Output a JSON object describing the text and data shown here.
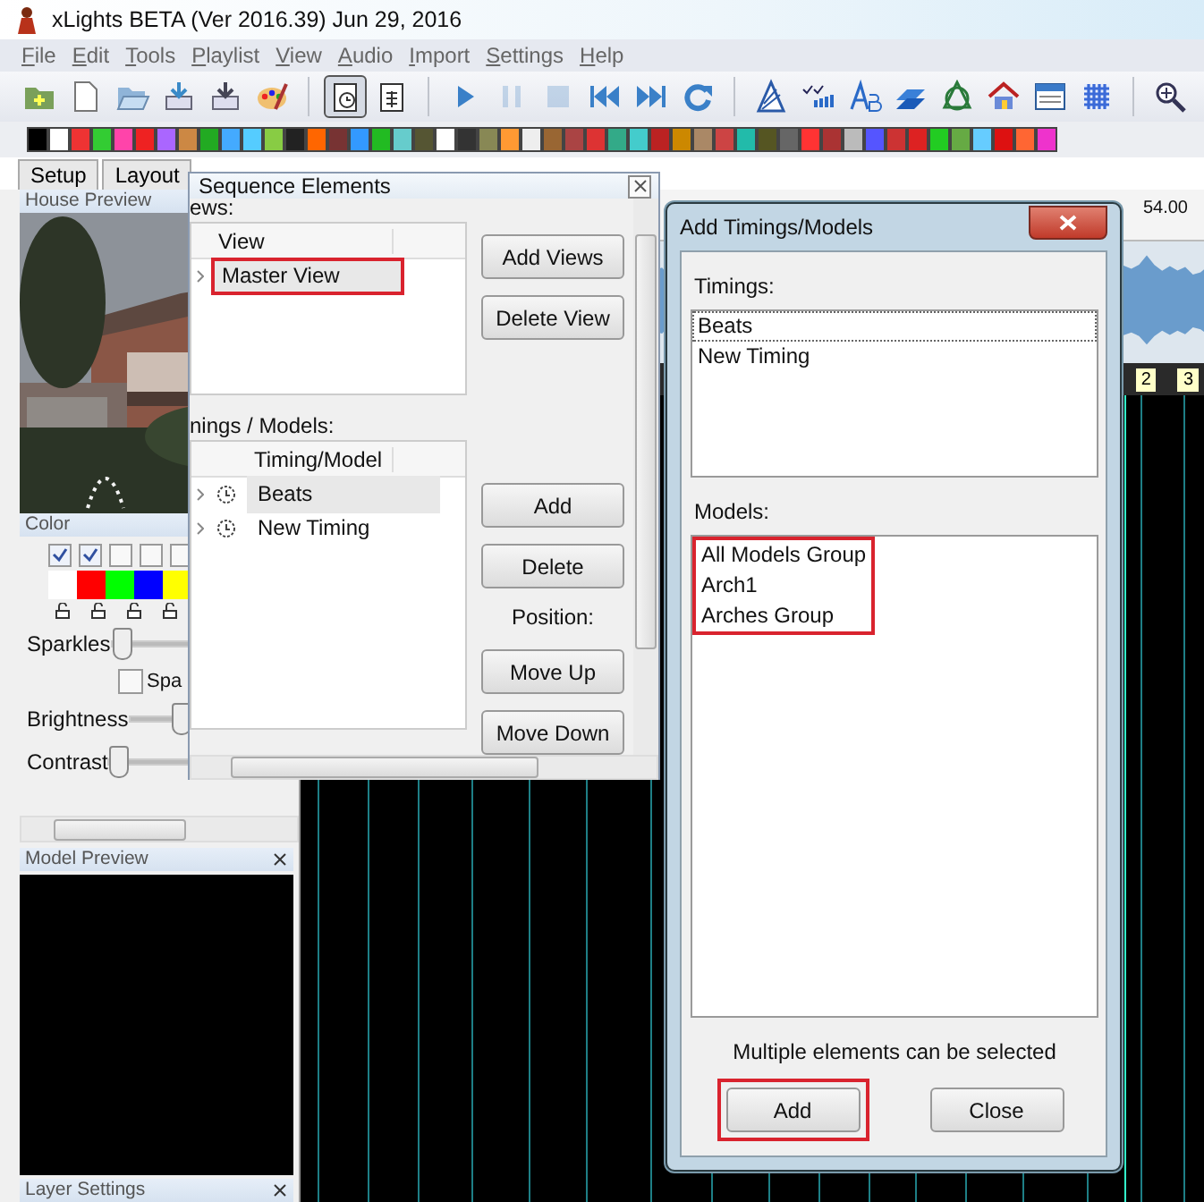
{
  "window": {
    "title": "xLights BETA (Ver 2016.39) Jun 29, 2016"
  },
  "menu": [
    "File",
    "Edit",
    "Tools",
    "Playlist",
    "View",
    "Audio",
    "Import",
    "Settings",
    "Help"
  ],
  "toolbar": [
    {
      "kind": "new-folder",
      "pressed": false,
      "disabled": false
    },
    {
      "kind": "new",
      "pressed": false,
      "disabled": false
    },
    {
      "kind": "open",
      "pressed": false,
      "disabled": false
    },
    {
      "kind": "save",
      "pressed": false,
      "disabled": false
    },
    {
      "kind": "save-as",
      "pressed": false,
      "disabled": false
    },
    {
      "kind": "palette",
      "pressed": false,
      "disabled": false
    },
    {
      "kind": "separator"
    },
    {
      "kind": "clock-board",
      "pressed": true,
      "disabled": false
    },
    {
      "kind": "grid-board",
      "pressed": false,
      "disabled": false
    },
    {
      "kind": "separator"
    },
    {
      "kind": "play",
      "pressed": false,
      "disabled": false
    },
    {
      "kind": "pause",
      "pressed": false,
      "disabled": true
    },
    {
      "kind": "stop",
      "pressed": false,
      "disabled": true
    },
    {
      "kind": "first",
      "pressed": false,
      "disabled": false
    },
    {
      "kind": "last",
      "pressed": false,
      "disabled": false
    },
    {
      "kind": "repeat",
      "pressed": false,
      "disabled": false
    },
    {
      "kind": "separator"
    },
    {
      "kind": "triangle",
      "pressed": false,
      "disabled": false
    },
    {
      "kind": "checks",
      "pressed": false,
      "disabled": false
    },
    {
      "kind": "text-style",
      "pressed": false,
      "disabled": false
    },
    {
      "kind": "layers",
      "pressed": false,
      "disabled": false
    },
    {
      "kind": "ring",
      "pressed": false,
      "disabled": false
    },
    {
      "kind": "house",
      "pressed": false,
      "disabled": false
    },
    {
      "kind": "window",
      "pressed": false,
      "disabled": false
    },
    {
      "kind": "grid",
      "pressed": false,
      "disabled": false
    },
    {
      "kind": "separator"
    },
    {
      "kind": "zoom",
      "pressed": false,
      "disabled": false
    }
  ],
  "tabs": [
    {
      "label": "Setup",
      "selected": false
    },
    {
      "label": "Layout",
      "selected": false
    }
  ],
  "house_preview": {
    "title": "House Preview",
    "kind": "picture"
  },
  "color_panel": {
    "title": "Color",
    "palette": [
      {
        "color": "#ffffff",
        "checked": true
      },
      {
        "color": "#ff0000",
        "checked": true
      },
      {
        "color": "#00ff00",
        "checked": false
      },
      {
        "color": "#0000ff",
        "checked": false
      },
      {
        "color": "#ffff00",
        "checked": false
      }
    ],
    "controls": [
      {
        "kind": "slider",
        "label": "Sparkles",
        "level": 0
      },
      {
        "kind": "checkbox",
        "label": "Spa",
        "checked": false
      },
      {
        "kind": "slider",
        "label": "Brightness",
        "level": 0.25
      },
      {
        "kind": "slider",
        "label": "Contrast",
        "level": 0
      }
    ]
  },
  "model_preview": {
    "title": "Model Preview"
  },
  "layer_settings": {
    "title": "Layer Settings"
  },
  "timeline": {
    "ruler_label": "54.00",
    "timing_marks": [
      "2",
      "3"
    ]
  },
  "sequence_elements": {
    "title": "Sequence Elements",
    "views_label": "ews:",
    "views_table": {
      "columns": [
        "View"
      ],
      "rows": [
        {
          "name": "Master View",
          "selected": true,
          "highlighted": true
        }
      ]
    },
    "view_buttons": [
      "Add Views",
      "Delete View"
    ],
    "models_label": "nings / Models:",
    "models_table": {
      "columns": [
        "Timing/Model"
      ],
      "rows": [
        {
          "name": "Beats",
          "selected": true,
          "highlighted": false
        },
        {
          "name": "New Timing",
          "selected": false,
          "highlighted": false
        }
      ]
    },
    "buttons": [
      "Add",
      "Delete"
    ],
    "position_label": "Position:",
    "position_buttons": [
      "Move Up",
      "Move Down"
    ]
  },
  "add_dialog": {
    "title": "Add Timings/Models",
    "timings_label": "Timings:",
    "timings": [
      {
        "name": "Beats",
        "focused": true
      },
      {
        "name": "New Timing",
        "focused": false
      }
    ],
    "models_label": "Models:",
    "models": [
      "All Models Group",
      "Arch1",
      "Arches Group"
    ],
    "models_highlighted": true,
    "note": "Multiple elements can be selected",
    "buttons": [
      {
        "label": "Add",
        "highlighted": true
      },
      {
        "label": "Close",
        "highlighted": false
      }
    ]
  }
}
